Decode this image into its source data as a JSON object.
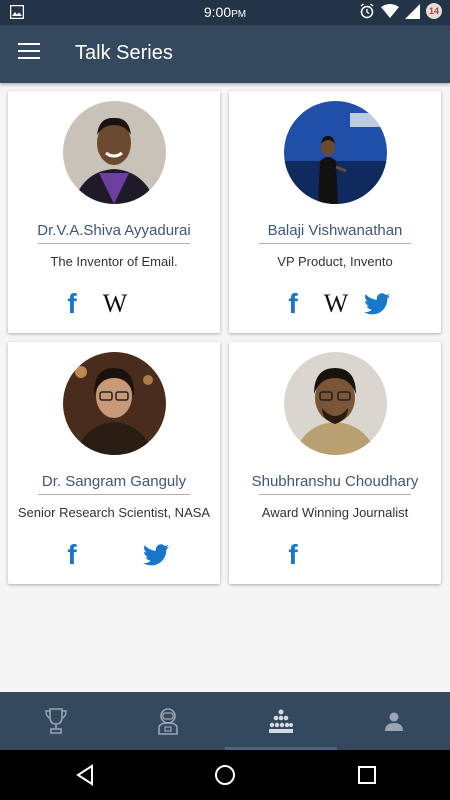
{
  "status_bar": {
    "time": "9:00",
    "time_suffix": "PM",
    "notification_count": "14",
    "icons": [
      "image-icon",
      "alarm-icon",
      "wifi-icon",
      "signal-icon",
      "battery-icon"
    ]
  },
  "app_bar": {
    "title": "Talk Series",
    "menu_icon": "hamburger-menu-icon"
  },
  "speakers": [
    {
      "name": "Dr.V.A.Shiva Ayyadurai",
      "subtitle": "The Inventor of Email.",
      "socials": [
        "facebook",
        "wikipedia"
      ]
    },
    {
      "name": "Balaji Vishwanathan",
      "subtitle": "VP Product, Invento",
      "socials": [
        "facebook",
        "wikipedia",
        "twitter"
      ]
    },
    {
      "name": "Dr. Sangram Ganguly",
      "subtitle": "Senior Research Scientist, NASA",
      "socials": [
        "facebook",
        "twitter"
      ]
    },
    {
      "name": "Shubhranshu Choudhary",
      "subtitle": "Award Winning Journalist",
      "socials": [
        "facebook"
      ]
    }
  ],
  "social_labels": {
    "facebook": "f",
    "wikipedia": "W"
  },
  "bottom_nav": [
    {
      "icon": "trophy-icon"
    },
    {
      "icon": "astronaut-icon"
    },
    {
      "icon": "audience-icon",
      "active": true
    },
    {
      "icon": "person-icon"
    }
  ],
  "colors": {
    "app_bar": "#34495e",
    "status_bar": "#243447",
    "name_text": "#3f5875",
    "facebook": "#1877c9",
    "twitter": "#1da1f2"
  }
}
